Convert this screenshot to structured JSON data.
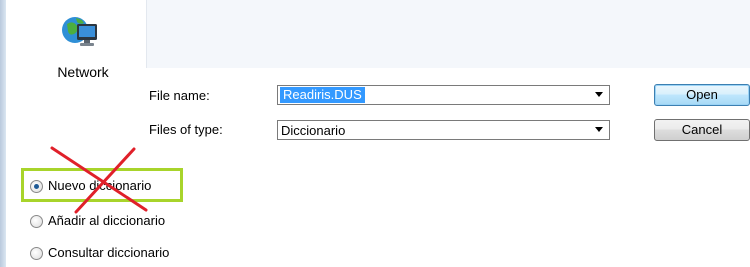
{
  "places": {
    "network_label": "Network"
  },
  "file_fields": {
    "file_name_label": "File name:",
    "file_name_value": "Readiris.DUS",
    "files_of_type_label": "Files of type:",
    "files_of_type_value": "Diccionario"
  },
  "buttons": {
    "open": "Open",
    "cancel": "Cancel"
  },
  "dictionary_options": [
    {
      "label": "Nuevo diccionario",
      "checked": true
    },
    {
      "label": "Añadir al diccionario",
      "checked": false
    },
    {
      "label": "Consultar diccionario",
      "checked": false
    }
  ],
  "colors": {
    "highlight_box": "#a8d42b",
    "cross_mark": "#e0202a",
    "selection": "#3399ff"
  }
}
